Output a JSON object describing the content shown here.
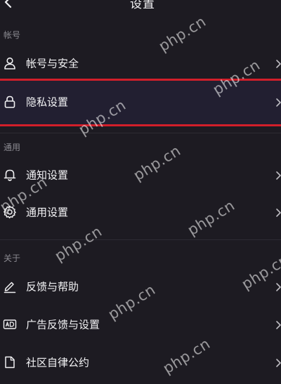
{
  "header": {
    "title": "设置"
  },
  "sections": [
    {
      "title": "帐号",
      "items": [
        {
          "label": "帐号与安全",
          "icon": "user-icon"
        },
        {
          "label": "隐私设置",
          "icon": "lock-icon"
        }
      ]
    },
    {
      "title": "通用",
      "items": [
        {
          "label": "通知设置",
          "icon": "bell-icon"
        },
        {
          "label": "通用设置",
          "icon": "gear-icon"
        }
      ]
    },
    {
      "title": "关于",
      "items": [
        {
          "label": "反馈与帮助",
          "icon": "edit-icon"
        },
        {
          "label": "广告反馈与设置",
          "icon": "ad-icon"
        },
        {
          "label": "社区自律公约",
          "icon": "document-icon"
        }
      ]
    }
  ],
  "watermark": "php.cn",
  "colors": {
    "background": "#1d1b22",
    "highlight": "#221f31",
    "accent_red": "#d21f2a",
    "text": "#f3f3f5",
    "muted": "#8b8a91"
  }
}
